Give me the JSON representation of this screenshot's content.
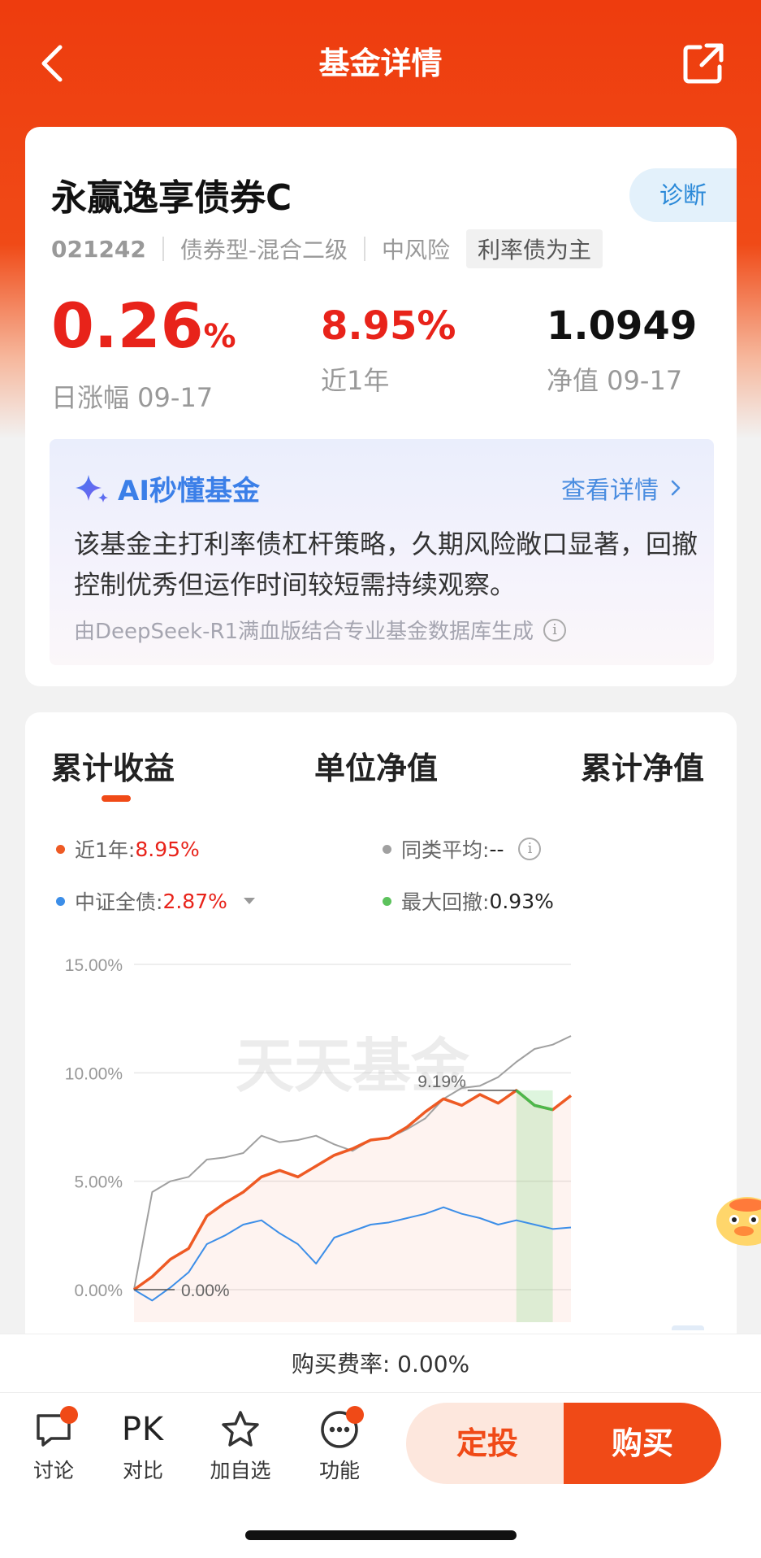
{
  "header": {
    "title": "基金详情",
    "back_icon": "chevron-left-icon",
    "share_icon": "share-external-icon"
  },
  "fund": {
    "name": "永赢逸享债券C",
    "diagnose_label": "诊断",
    "code": "021242",
    "type": "债券型-混合二级",
    "risk": "中风险",
    "tag": "利率债为主",
    "daily_change_value": "0.26",
    "daily_change_unit": "%",
    "daily_change_label": "日涨幅 09-17",
    "one_year_value": "8.95%",
    "one_year_label": "近1年",
    "nav_value": "1.0949",
    "nav_label": "净值 09-17"
  },
  "ai": {
    "title": "AI秒懂基金",
    "more_label": "查看详情",
    "summary": "该基金主打利率债杠杆策略，久期风险敞口显著，回撤控制优秀但运作时间较短需持续观察。",
    "footnote": "由DeepSeek-R1满血版结合专业基金数据库生成"
  },
  "tabs": [
    "累计收益",
    "单位净值",
    "累计净值"
  ],
  "legend": {
    "fund_label": "近1年:",
    "fund_value": "8.95%",
    "peer_label": "同类平均:",
    "peer_value": "--",
    "index_label": "中证全债:",
    "index_value": "2.87%",
    "drawdown_label": "最大回撤:",
    "drawdown_value": "0.93%"
  },
  "colors": {
    "brand": "#f04a17",
    "fund_line": "#ee5a24",
    "peer_line": "#a0a0a0",
    "index_line": "#3c8ee8",
    "drawdown_area": "#7dd67d",
    "up_red": "#e8231a"
  },
  "chart_data": {
    "type": "line",
    "ylim": [
      -1.5,
      15
    ],
    "y_ticks": [
      "15.00%",
      "10.00%",
      "5.00%",
      "0.00%"
    ],
    "y_tick_values": [
      15,
      10,
      5,
      0
    ],
    "annotations": {
      "peak_label": "9.19%",
      "start_label": "0.00%",
      "watermark": "天天基金"
    },
    "x": [
      0,
      1,
      2,
      3,
      4,
      5,
      6,
      7,
      8,
      9,
      10,
      11,
      12,
      13,
      14,
      15,
      16,
      17,
      18,
      19,
      20,
      21,
      22,
      23,
      24
    ],
    "series": [
      {
        "name": "近1年",
        "values": [
          0.0,
          0.6,
          1.4,
          1.9,
          3.4,
          4.0,
          4.5,
          5.2,
          5.5,
          5.2,
          5.7,
          6.2,
          6.5,
          6.9,
          7.0,
          7.5,
          8.2,
          8.8,
          8.5,
          9.0,
          8.6,
          9.19,
          8.5,
          8.3,
          8.95
        ]
      },
      {
        "name": "同类平均",
        "values": [
          0.0,
          4.5,
          5.0,
          5.2,
          6.0,
          6.1,
          6.3,
          7.1,
          6.8,
          6.9,
          7.1,
          6.7,
          6.4,
          6.9,
          7.0,
          7.4,
          7.9,
          8.8,
          9.3,
          9.4,
          9.8,
          10.5,
          11.1,
          11.3,
          11.7
        ]
      },
      {
        "name": "中证全债",
        "values": [
          0.0,
          -0.5,
          0.1,
          0.8,
          2.1,
          2.5,
          3.0,
          3.2,
          2.6,
          2.1,
          1.2,
          2.4,
          2.7,
          3.0,
          3.1,
          3.3,
          3.5,
          3.8,
          3.5,
          3.3,
          3.0,
          3.2,
          3.0,
          2.8,
          2.87
        ]
      }
    ],
    "drawdown_region": [
      21,
      23
    ]
  },
  "bottom": {
    "fee_text": "购买费率: 0.00%",
    "nav": [
      {
        "label": "讨论",
        "icon": "chat-bubble-icon"
      },
      {
        "label": "对比",
        "icon": "pk-icon",
        "glyph": "PK"
      },
      {
        "label": "加自选",
        "icon": "star-icon"
      },
      {
        "label": "功能",
        "icon": "more-dots-icon"
      }
    ],
    "dingtou_label": "定投",
    "buy_label": "购买"
  }
}
